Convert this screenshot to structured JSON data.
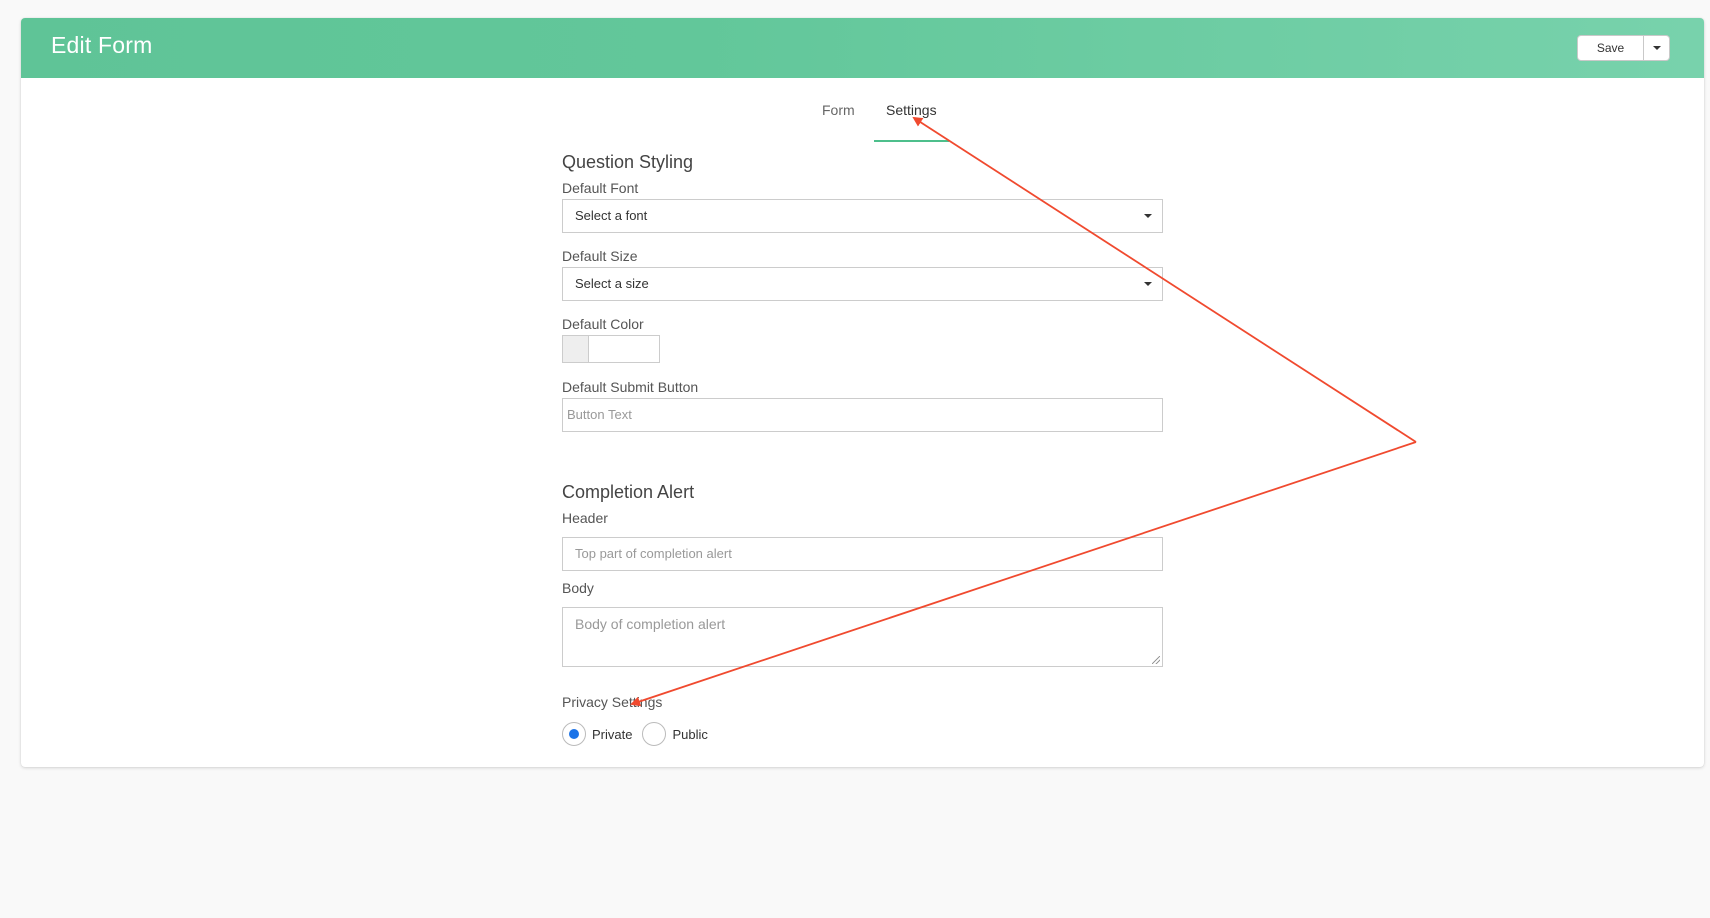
{
  "header": {
    "title": "Edit Form",
    "save_label": "Save",
    "brand_color": "#5fc497"
  },
  "tabs": [
    {
      "label": "Form",
      "active": false
    },
    {
      "label": "Settings",
      "active": true
    }
  ],
  "question_styling": {
    "title": "Question Styling",
    "default_font": {
      "label": "Default Font",
      "value": "Select a font"
    },
    "default_size": {
      "label": "Default Size",
      "value": "Select a size"
    },
    "default_color": {
      "label": "Default Color",
      "value": "#eeeeee"
    },
    "default_submit": {
      "label": "Default Submit Button",
      "placeholder": "Button Text"
    }
  },
  "completion_alert": {
    "title": "Completion Alert",
    "header": {
      "label": "Header",
      "placeholder": "Top part of completion alert"
    },
    "body": {
      "label": "Body",
      "placeholder": "Body of completion alert"
    }
  },
  "privacy": {
    "label": "Privacy Settings",
    "options": [
      {
        "label": "Private",
        "checked": true
      },
      {
        "label": "Public",
        "checked": false
      }
    ]
  },
  "annotation": {
    "color": "#f04a2f"
  }
}
